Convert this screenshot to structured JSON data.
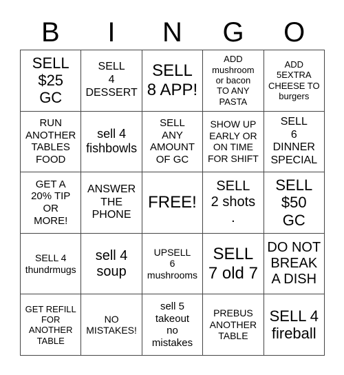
{
  "header": {
    "letters": [
      "B",
      "I",
      "N",
      "G",
      "O"
    ]
  },
  "cells": [
    "SELL\n$25\nGC",
    "SELL\n4\nDESSERT",
    "SELL\n8 APP!",
    "ADD\nmushroom\nor bacon\nTO ANY\nPASTA",
    "ADD\n5EXTRA\nCHEESE TO\nburgers",
    "RUN\nANOTHER\nTABLES\nFOOD",
    "sell 4\nfishbowls",
    "SELL\nANY\nAMOUNT\nOF GC",
    "SHOW UP\nEARLY OR\nON TIME\nFOR SHIFT",
    "SELL\n6\nDINNER\nSPECIAL",
    "GET A\n20% TIP\nOR\nMORE!",
    "ANSWER\nTHE\nPHONE",
    "FREE!",
    "SELL\n2 shots\n.",
    "SELL\n$50\nGC",
    "SELL 4\nthundrmugs",
    "sell 4\nsoup",
    "UPSELL\n6\nmushrooms",
    "SELL\n7 old 7",
    "DO NOT\nBREAK\nA DISH",
    "GET REFILL\nFOR\nANOTHER\nTABLE",
    "NO\nMISTAKES!",
    "sell 5\ntakeout\nno\nmistakes",
    "PREBUS\nANOTHER\nTABLE",
    "SELL 4\nfireball"
  ]
}
